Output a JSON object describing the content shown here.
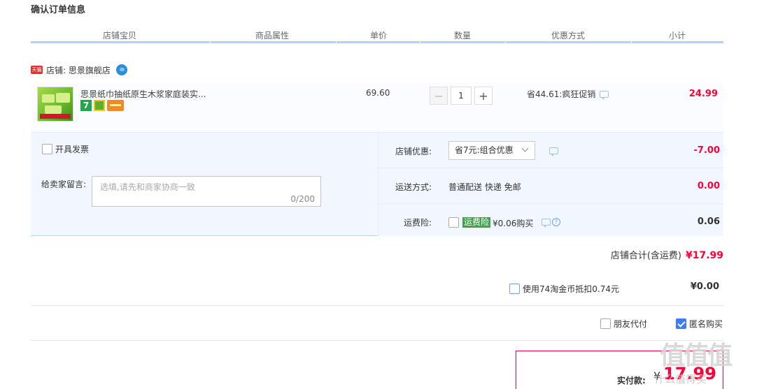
{
  "page": {
    "title": "确认订单信息"
  },
  "table_headers": [
    "店铺宝贝",
    "商品属性",
    "单价",
    "数量",
    "优惠方式",
    "小计"
  ],
  "shop": {
    "badge": "天猫",
    "label": "店铺: 思景旗舰店"
  },
  "item": {
    "title": "思景纸巾抽纸原生木浆家庭装实...",
    "badge_7": "7",
    "price": "69.60",
    "quantity": "1",
    "promo": "省44.61:疯狂促销",
    "subtotal": "24.99"
  },
  "invoice": {
    "label": "开具发票"
  },
  "message": {
    "label": "给卖家留言:",
    "placeholder": "选填,请先和商家协商一致",
    "count": "0/200"
  },
  "discount": {
    "label": "店铺优惠:",
    "selected": "省7元:组合优惠",
    "amount": "-7.00"
  },
  "shipping": {
    "label": "运送方式:",
    "value": "普通配送 快递 免邮",
    "amount": "0.00"
  },
  "insurance": {
    "label": "运费险:",
    "tag": "运费险",
    "text": "¥0.06购买",
    "amount": "0.06",
    "help": "?"
  },
  "shop_total": {
    "label": "店铺合计(含运费)",
    "amount": "¥17.99"
  },
  "coins": {
    "label": "使用74淘金币抵扣0.74元",
    "amount": "¥0.00"
  },
  "friend_pay": {
    "label": "朋友代付"
  },
  "anonymous": {
    "label": "匿名购买",
    "checked": true
  },
  "payment": {
    "label": "实付款:",
    "currency": "¥",
    "amount": "17.99"
  },
  "watermark": {
    "logo": "值值值",
    "url": "什么值得买"
  },
  "colors": {
    "accent": "#ff0036",
    "header_line": "#b2d1ff",
    "panel": "#f2f7ff"
  }
}
